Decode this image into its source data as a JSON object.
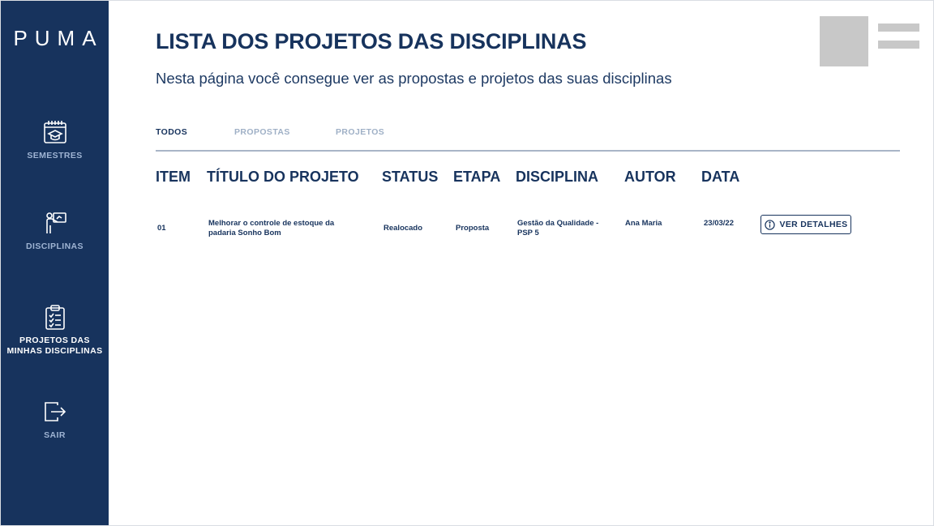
{
  "sidebar": {
    "logo": "PUMA",
    "items": [
      {
        "label": "SEMESTRES",
        "icon": "calendar-graduation-icon"
      },
      {
        "label": "DISCIPLINAS",
        "icon": "teacher-board-icon"
      },
      {
        "label": "PROJETOS DAS MINHAS DISCIPLINAS",
        "icon": "clipboard-checklist-icon"
      },
      {
        "label": "SAIR",
        "icon": "logout-icon"
      }
    ]
  },
  "header": {
    "title": "LISTA DOS PROJETOS DAS DISCIPLINAS",
    "subtitle": "Nesta página você consegue ver as propostas e projetos das suas disciplinas"
  },
  "tabs": [
    {
      "label": "TODOS",
      "active": true
    },
    {
      "label": "PROPOSTAS",
      "active": false
    },
    {
      "label": "PROJETOS",
      "active": false
    }
  ],
  "table": {
    "columns": [
      "ITEM",
      "TÍTULO DO PROJETO",
      "STATUS",
      "ETAPA",
      "DISCIPLINA",
      "AUTOR",
      "DATA"
    ],
    "rows": [
      {
        "item": "01",
        "title": "Melhorar o controle de estoque da padaria Sonho Bom",
        "status": "Realocado",
        "etapa": "Proposta",
        "disciplina": "Gestão da Qualidade - PSP 5",
        "autor": "Ana Maria",
        "data": "23/03/22",
        "action": "VER DETALHES"
      }
    ]
  },
  "colors": {
    "sidebar_bg": "#17335d",
    "primary_text": "#17335d",
    "inactive_tab": "#9fb0c6",
    "placeholder_gray": "#c8c8c8"
  }
}
